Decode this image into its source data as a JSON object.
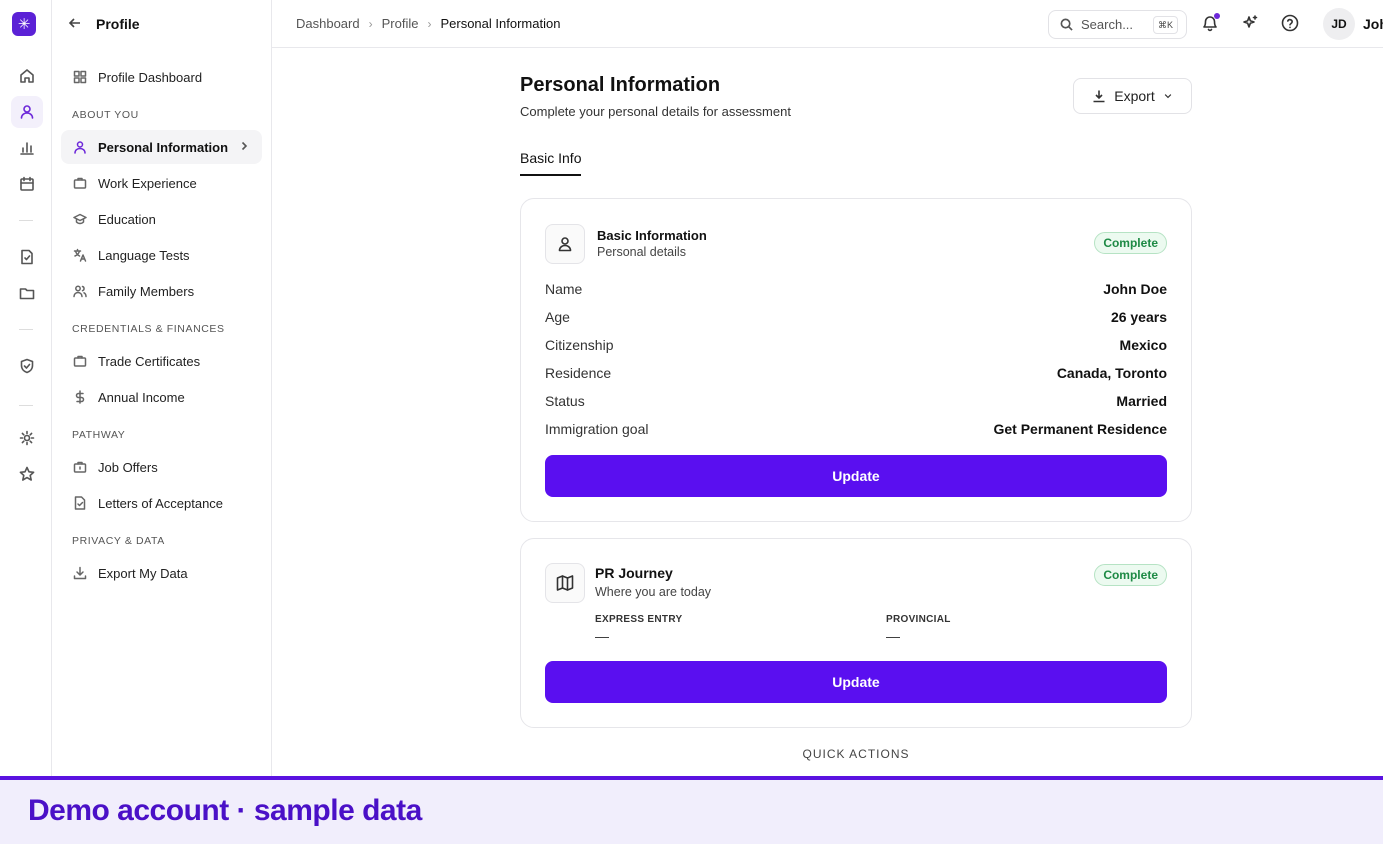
{
  "app": {
    "logo_icon": "asterisk-logo-icon",
    "accent": "#5a0ff0"
  },
  "rail": {
    "icons": [
      "home-icon",
      "user-icon",
      "bar-chart-icon",
      "calendar-icon",
      "file-check-icon",
      "folder-icon",
      "shield-check-icon",
      "gear-icon",
      "star-icon"
    ]
  },
  "sidebar": {
    "title": "Profile",
    "top_item": {
      "label": "Profile Dashboard",
      "icon": "grid-icon"
    },
    "sections": [
      {
        "label": "ABOUT YOU",
        "items": [
          {
            "label": "Personal Information",
            "icon": "user-icon",
            "active": true
          },
          {
            "label": "Work Experience",
            "icon": "briefcase-icon"
          },
          {
            "label": "Education",
            "icon": "graduation-cap-icon"
          },
          {
            "label": "Language Tests",
            "icon": "translate-icon"
          },
          {
            "label": "Family Members",
            "icon": "users-icon"
          }
        ]
      },
      {
        "label": "CREDENTIALS & FINANCES",
        "items": [
          {
            "label": "Trade Certificates",
            "icon": "briefcase-icon"
          },
          {
            "label": "Annual Income",
            "icon": "dollar-icon"
          }
        ]
      },
      {
        "label": "PATHWAY",
        "items": [
          {
            "label": "Job Offers",
            "icon": "briefcase-icon"
          },
          {
            "label": "Letters of Acceptance",
            "icon": "file-check-icon"
          }
        ]
      },
      {
        "label": "PRIVACY & DATA",
        "items": [
          {
            "label": "Export My Data",
            "icon": "download-icon"
          }
        ]
      }
    ]
  },
  "topbar": {
    "breadcrumbs": [
      "Dashboard",
      "Profile",
      "Personal Information"
    ],
    "search_placeholder": "Search...",
    "search_shortcut": "⌘K",
    "avatar_initials": "JD",
    "user_name": "John"
  },
  "main": {
    "title": "Personal Information",
    "subtitle": "Complete your personal details for assessment",
    "export_label": "Export",
    "tabs": [
      "Basic Info"
    ],
    "basic_card": {
      "title": "Basic Information",
      "subtitle": "Personal details",
      "badge": "Complete",
      "fields": [
        {
          "label": "Name",
          "value": "John Doe"
        },
        {
          "label": "Age",
          "value": "26 years"
        },
        {
          "label": "Citizenship",
          "value": "Mexico"
        },
        {
          "label": "Residence",
          "value": "Canada, Toronto"
        },
        {
          "label": "Status",
          "value": "Married"
        },
        {
          "label": "Immigration goal",
          "value": "Get Permanent Residence"
        }
      ],
      "button": "Update"
    },
    "journey_card": {
      "title": "PR Journey",
      "subtitle": "Where you are today",
      "badge": "Complete",
      "express_label": "EXPRESS ENTRY",
      "express_value": "—",
      "provincial_label": "PROVINCIAL",
      "provincial_value": "—",
      "button": "Update"
    },
    "quick_actions_label": "QUICK ACTIONS"
  },
  "banner": {
    "text": "Demo account · sample data"
  }
}
